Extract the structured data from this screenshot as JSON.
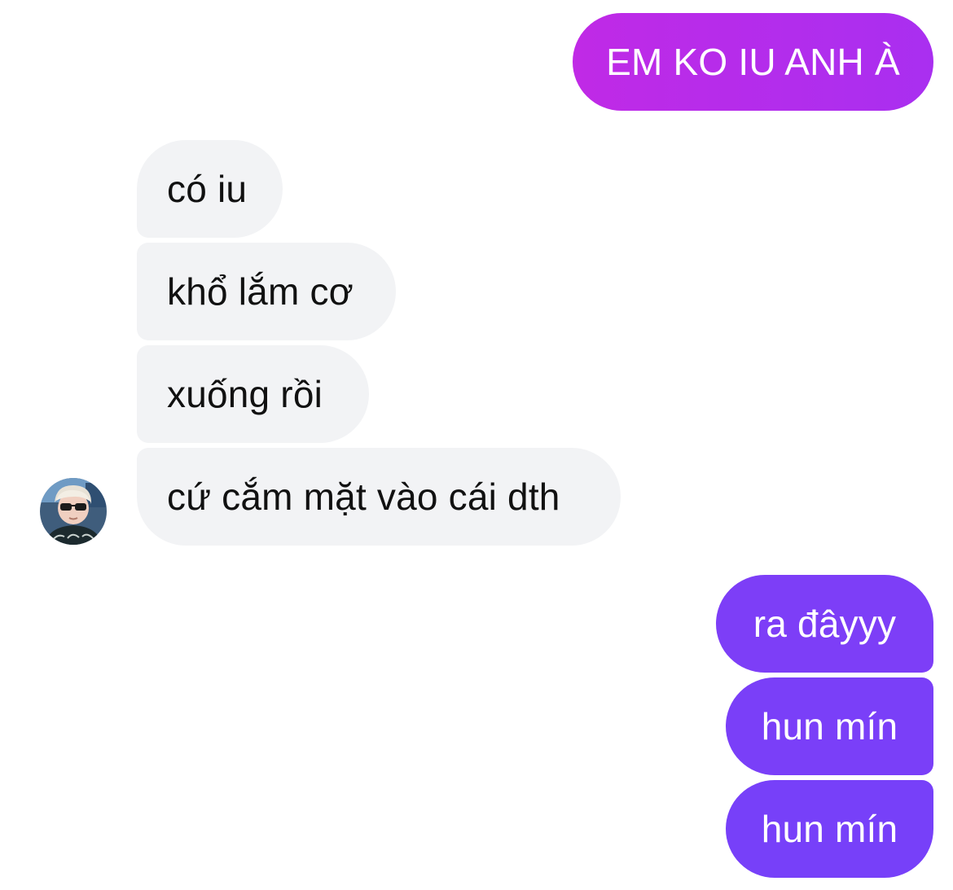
{
  "conversation": {
    "messages": [
      {
        "sender": "me",
        "text": "EM KO IU ANH À",
        "color": "#b92ceb"
      },
      {
        "sender": "them",
        "text": "có iu"
      },
      {
        "sender": "them",
        "text": "khổ lắm cơ"
      },
      {
        "sender": "them",
        "text": "xuống rồi"
      },
      {
        "sender": "them",
        "text": "cứ cắm mặt vào cái dth"
      },
      {
        "sender": "me",
        "text": "ra đâyyy",
        "color": "#7d3ef7"
      },
      {
        "sender": "me",
        "text": "hun mín",
        "color": "#7a3ff8"
      },
      {
        "sender": "me",
        "text": "hun mín",
        "color": "#7740f9"
      }
    ],
    "contact": {
      "avatar_icon": "profile-photo-avatar"
    },
    "colors": {
      "incoming_bubble": "#f2f3f5",
      "incoming_text": "#111111",
      "outgoing_text": "#ffffff"
    }
  }
}
